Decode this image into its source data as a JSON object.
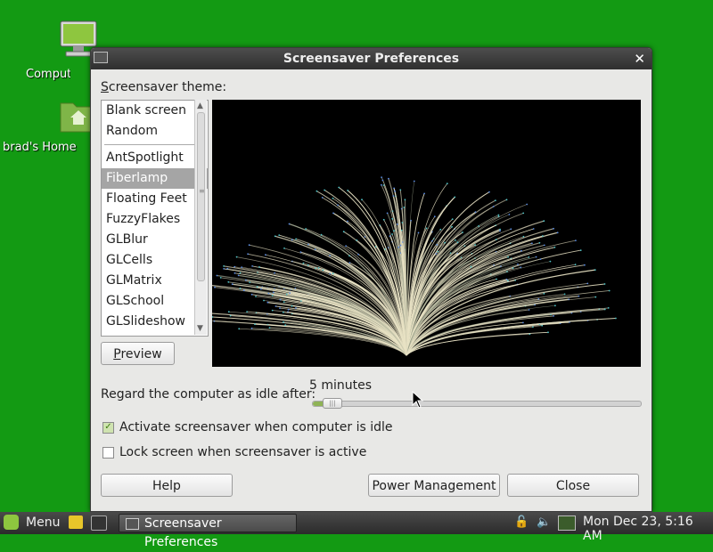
{
  "desktop": {
    "icons": [
      {
        "label": "Computer"
      },
      {
        "label": "brad's Home"
      }
    ]
  },
  "window": {
    "title": "Screensaver Preferences",
    "theme_label": "Screensaver theme:",
    "themes": [
      "Blank screen",
      "Random",
      "AntSpotlight",
      "Fiberlamp",
      "Floating Feet",
      "FuzzyFlakes",
      "GLBlur",
      "GLCells",
      "GLMatrix",
      "GLSchool",
      "GLSlideshow"
    ],
    "selected_theme": "Fiberlamp",
    "preview_button": "Preview",
    "idle_label": "Regard the computer as idle after:",
    "idle_value": "5 minutes",
    "idle_slider_fraction": 0.04,
    "activate_checkbox": {
      "label": "Activate screensaver when computer is idle",
      "checked": true
    },
    "lock_checkbox": {
      "label": "Lock screen when screensaver is active",
      "checked": false
    },
    "help_button": "Help",
    "power_button": "Power Management",
    "close_button": "Close"
  },
  "taskbar": {
    "menu_label": "Menu",
    "task_label": "Screensaver Preferences",
    "clock": "Mon Dec 23,  5:16 AM"
  },
  "colors": {
    "desktop_bg": "#139a13",
    "accent": "#8fb356",
    "fiber": "#e8e2c4"
  }
}
